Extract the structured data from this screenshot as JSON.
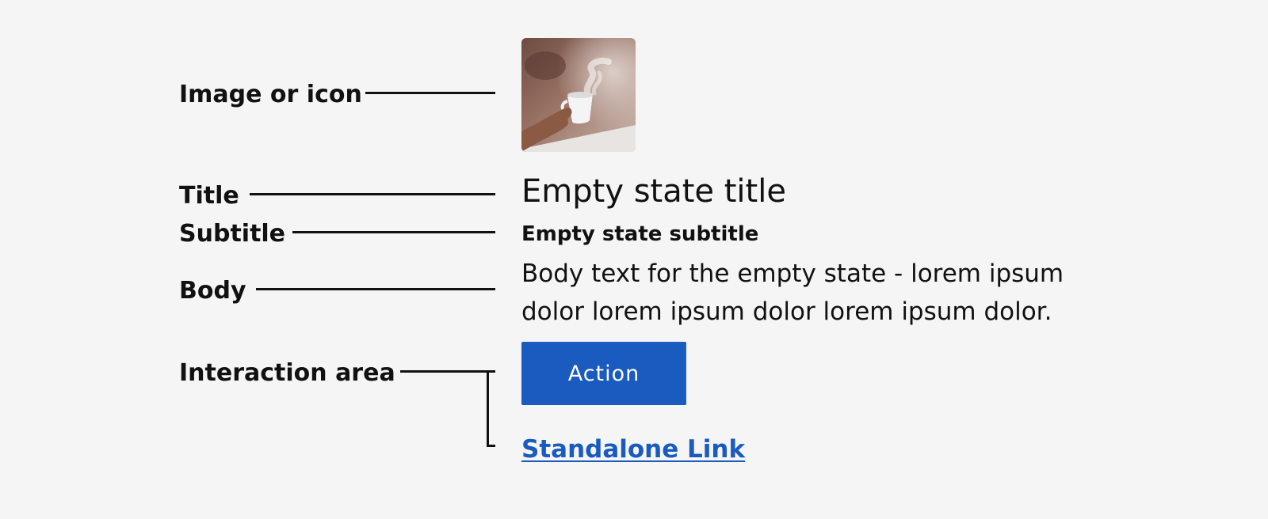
{
  "annotations": {
    "image_or_icon": "Image or icon",
    "title": "Title",
    "subtitle": "Subtitle",
    "body": "Body",
    "interaction_area": "Interaction area"
  },
  "empty_state": {
    "image_icon": "coffee-cup-photo-icon",
    "title": "Empty state title",
    "subtitle": "Empty state subtitle",
    "body": "Body text for the empty state - lorem ipsum dolor lorem ipsum dolor lorem ipsum dolor.",
    "action_label": "Action",
    "link_label": "Standalone Link"
  },
  "colors": {
    "background": "#f5f5f5",
    "primary": "#1a5bbf",
    "text": "#111111"
  }
}
